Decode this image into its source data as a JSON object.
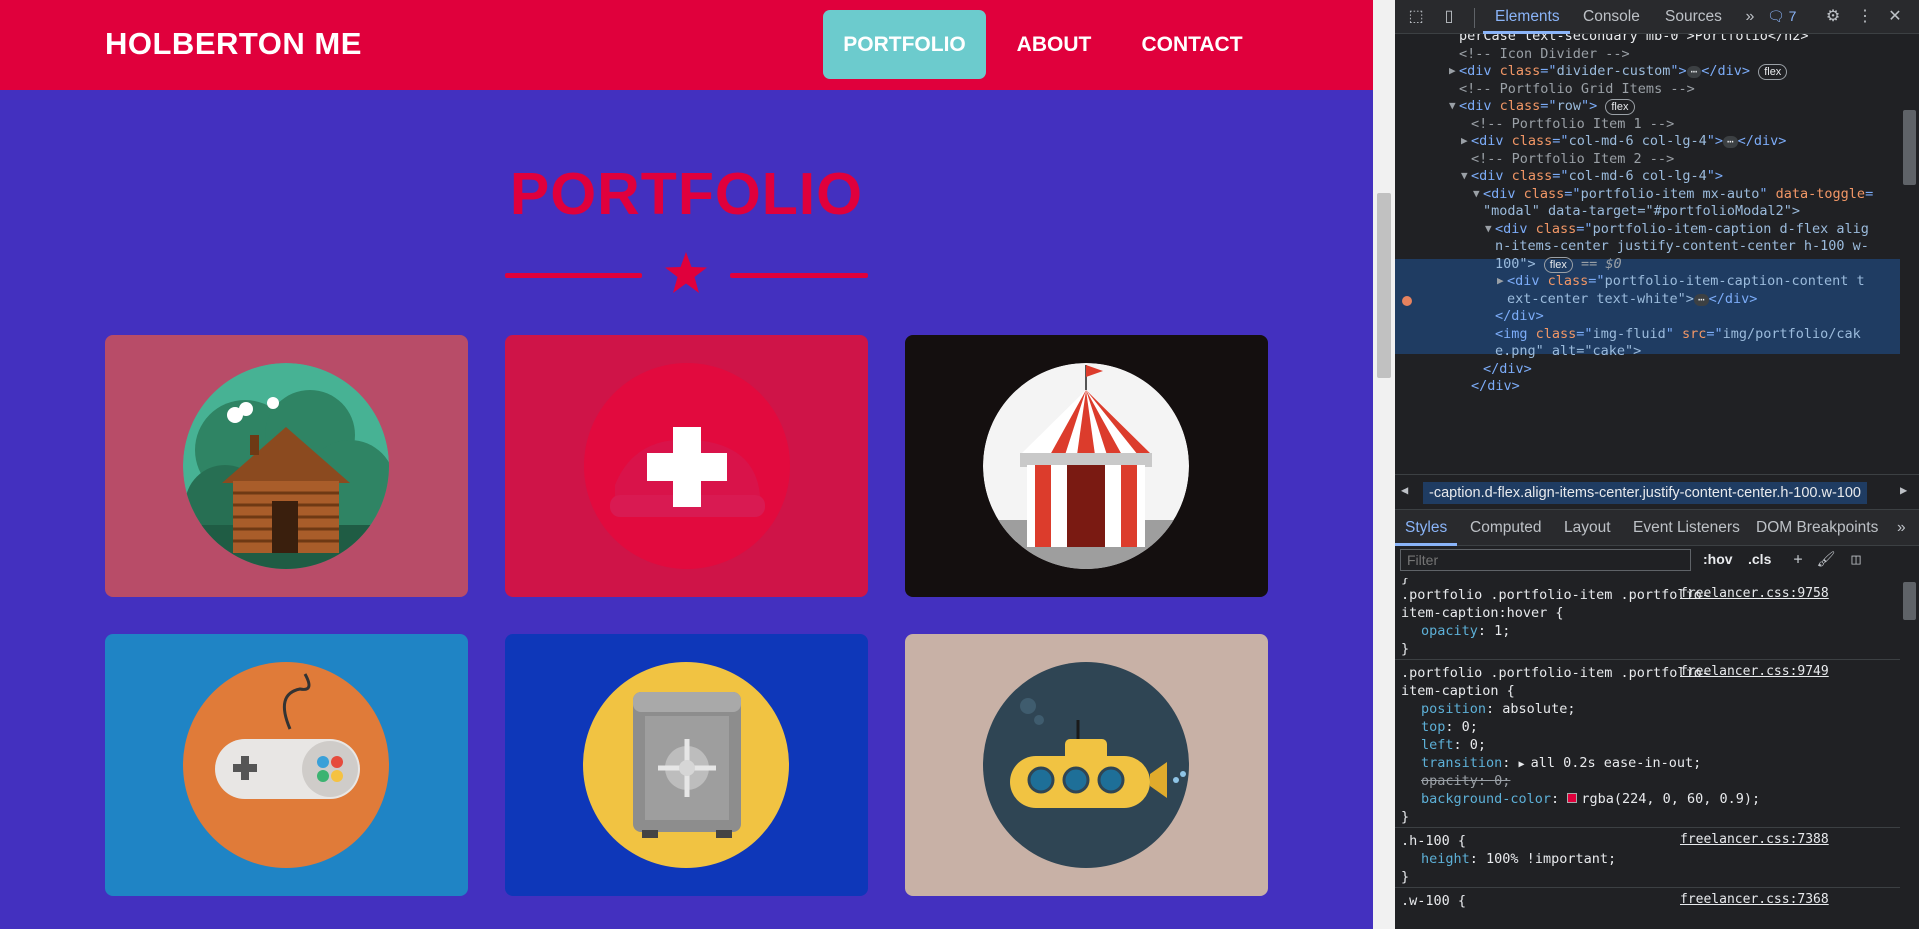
{
  "site": {
    "brand": "HOLBERTON ME",
    "nav": [
      "PORTFOLIO",
      "ABOUT",
      "CONTACT"
    ],
    "section_title": "PORTFOLIO",
    "colors": {
      "primary": "#e0003c",
      "background": "#4330bf",
      "nav_active": "#6ccbcd"
    },
    "tiles": [
      {
        "name": "cabin",
        "bg": "#b84c68"
      },
      {
        "name": "cake",
        "bg": "#cf1448"
      },
      {
        "name": "circus",
        "bg": "#140f0f"
      },
      {
        "name": "game",
        "bg": "#1f84c5"
      },
      {
        "name": "safe",
        "bg": "#0e37b9"
      },
      {
        "name": "submarine",
        "bg": "#c8b1a6"
      }
    ]
  },
  "devtools": {
    "tabs": [
      "Elements",
      "Console",
      "Sources"
    ],
    "issues_count": "7",
    "dom_lines": [
      {
        "indent": 0,
        "text": "perCase text-secondary mb-0 >Portfolio</h2>",
        "kind": "cut"
      },
      {
        "indent": 0,
        "text": "<!-- Icon Divider -->",
        "kind": "cmt"
      },
      {
        "indent": 0,
        "tag": "div",
        "attrs": [
          [
            "class",
            "divider-custom"
          ]
        ],
        "ellip": true,
        "close": "</div>",
        "badge": "flex",
        "arrow": "▶"
      },
      {
        "indent": 0,
        "text": "<!-- Portfolio Grid Items -->",
        "kind": "cmt"
      },
      {
        "indent": 0,
        "tag": "div",
        "attrs": [
          [
            "class",
            "row"
          ]
        ],
        "badge": "flex",
        "arrow": "▼"
      },
      {
        "indent": 1,
        "text": "<!-- Portfolio Item 1 -->",
        "kind": "cmt"
      },
      {
        "indent": 1,
        "tag": "div",
        "attrs": [
          [
            "class",
            "col-md-6 col-lg-4"
          ]
        ],
        "ellip": true,
        "close": "</div>",
        "arrow": "▶"
      },
      {
        "indent": 1,
        "text": "<!-- Portfolio Item 2 -->",
        "kind": "cmt"
      },
      {
        "indent": 1,
        "tag": "div",
        "attrs": [
          [
            "class",
            "col-md-6 col-lg-4"
          ]
        ],
        "arrow": "▼"
      },
      {
        "indent": 2,
        "tag": "div",
        "attrs": [
          [
            "class",
            "portfolio-item mx-auto"
          ],
          [
            "data-toggle",
            ""
          ]
        ],
        "arrow": "▼",
        "cut": true
      },
      {
        "indent": 2,
        "text": "\"modal\" data-target=\"#portfolioModal2\">",
        "kind": "cont"
      },
      {
        "indent": 3,
        "tag": "div",
        "attrs": [
          [
            "class",
            "portfolio-item-caption d-flex alig"
          ]
        ],
        "arrow": "▼",
        "cut": true,
        "selected": true
      },
      {
        "indent": 3,
        "text": "n-items-center justify-content-center h-100 w-",
        "kind": "contval",
        "selected": true
      },
      {
        "indent": 3,
        "text": "100\">",
        "kind": "contval",
        "badge": "flex",
        "tail": "== $0",
        "selected": true
      },
      {
        "indent": 4,
        "tag": "div",
        "attrs": [
          [
            "class",
            "portfolio-item-caption-content t"
          ]
        ],
        "arrow": "▶",
        "cut": true
      },
      {
        "indent": 4,
        "text": "ext-center text-white\">",
        "kind": "contval",
        "ellip": true,
        "close": "</div>"
      },
      {
        "indent": 3,
        "text": "</div>",
        "kind": "tag"
      },
      {
        "indent": 3,
        "tag": "img",
        "attrs": [
          [
            "class",
            "img-fluid"
          ],
          [
            "src",
            "img/portfolio/cak"
          ]
        ],
        "cut": true
      },
      {
        "indent": 3,
        "text": "e.png\" alt=\"cake\">",
        "kind": "contlink"
      },
      {
        "indent": 2,
        "text": "</div>",
        "kind": "tag"
      },
      {
        "indent": 1,
        "text": "</div>",
        "kind": "tag"
      }
    ],
    "breadcrumb": "-caption.d-flex.align-items-center.justify-content-center.h-100.w-100",
    "style_tabs": [
      "Styles",
      "Computed",
      "Layout",
      "Event Listeners",
      "DOM Breakpoints"
    ],
    "filter_placeholder": "Filter",
    "hov": ":hov",
    "cls": ".cls",
    "rules": [
      {
        "selector": [
          ".portfolio .portfolio-item .portfolio-",
          "item-caption:hover {"
        ],
        "source": "freelancer.css:9758",
        "props": [
          {
            "name": "opacity",
            "value": "1;"
          }
        ]
      },
      {
        "selector": [
          ".portfolio .portfolio-item .portfolio-",
          "item-caption {"
        ],
        "source": "freelancer.css:9749",
        "props": [
          {
            "name": "position",
            "value": "absolute;"
          },
          {
            "name": "top",
            "value": "0;"
          },
          {
            "name": "left",
            "value": "0;"
          },
          {
            "name": "transition",
            "value": "all 0.2s ease-in-out;"
          },
          {
            "name": "opacity",
            "value": "0;",
            "struck": true
          },
          {
            "name": "background-color",
            "value": "rgba(224, 0, 60, 0.9);"
          }
        ]
      },
      {
        "selector": [
          ".h-100 {"
        ],
        "source": "freelancer.css:7388",
        "props": [
          {
            "name": "height",
            "value": "100% !important;"
          }
        ]
      },
      {
        "selector": [
          ".w-100 {"
        ],
        "source": "freelancer.css:7368",
        "props": []
      }
    ]
  }
}
